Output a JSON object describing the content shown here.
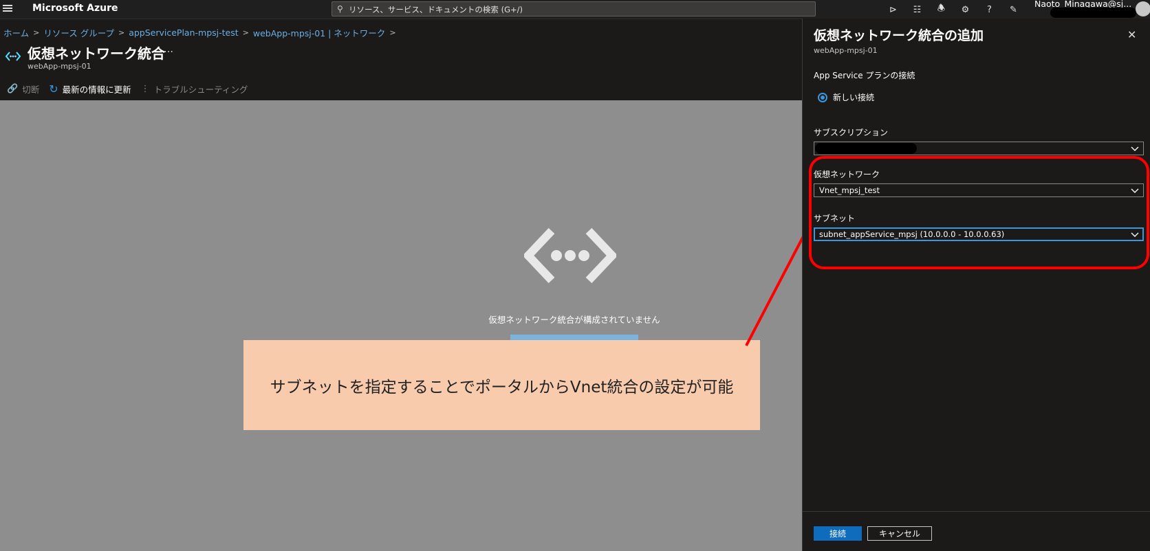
{
  "app": {
    "brand": "Microsoft Azure"
  },
  "search": {
    "placeholder": "リソース、サービス、ドキュメントの検索 (G+/)"
  },
  "topbar_icons": [
    "cloud-shell-icon",
    "directory-filter-icon",
    "notifications-icon",
    "settings-icon",
    "help-icon",
    "feedback-icon"
  ],
  "user": {
    "name": "Naoto_Minagawa@sj..."
  },
  "breadcrumb": [
    "ホーム",
    "リソース グループ",
    "appServicePlan-mpsj-test",
    "webApp-mpsj-01 | ネットワーク"
  ],
  "page": {
    "title": "仮想ネットワーク統合",
    "more": "…",
    "subtitle": "webApp-mpsj-01"
  },
  "commands": {
    "disconnect": "切断",
    "refresh": "最新の情報に更新",
    "troubleshoot": "トラブルシューティング"
  },
  "empty_state": {
    "message": "仮想ネットワーク統合が構成されていません"
  },
  "callout": {
    "text": "サブネットを指定することでポータルからVnet統合の設定が可能",
    "color": "#f8cbad",
    "arrow_color": "#ff0000"
  },
  "panel": {
    "title": "仮想ネットワーク統合の追加",
    "subtitle": "webApp-mpsj-01",
    "plan_connection_label": "App Service プランの接続",
    "radio_new": "新しい接続",
    "subscription_label": "サブスクリプション",
    "subscription_value": "",
    "vnet_label": "仮想ネットワーク",
    "vnet_value": "Vnet_mpsj_test",
    "subnet_label": "サブネット",
    "subnet_value": "subnet_appService_mpsj (10.0.0.0 - 10.0.0.63)",
    "connect_button": "接続",
    "cancel_button": "キャンセル"
  },
  "colors": {
    "accent": "#0f6cbd",
    "link": "#69afe5",
    "highlight": "#ff0000"
  }
}
